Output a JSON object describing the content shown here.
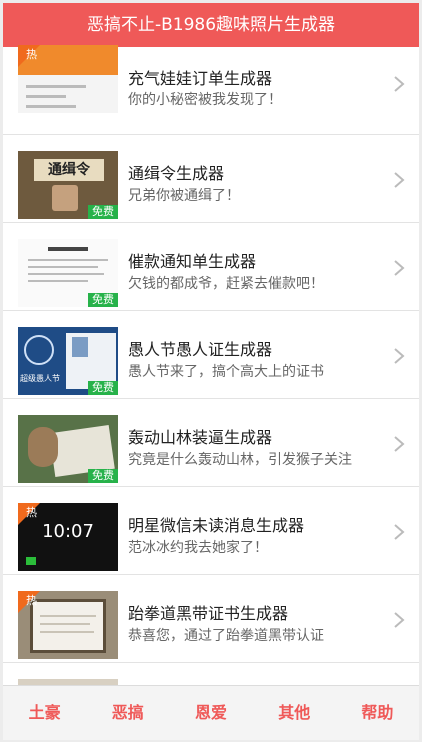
{
  "header": {
    "title": "恶搞不止-B1986趣味照片生成器"
  },
  "badges": {
    "hot": "热",
    "free": "免费"
  },
  "list": [
    {
      "title": "充气娃娃订单生成器",
      "subtitle": "你的小秘密被我发现了！",
      "badge": "hot"
    },
    {
      "title": "通缉令生成器",
      "subtitle": "兄弟你被通缉了！",
      "badge": "free",
      "thumb_text": "通缉令"
    },
    {
      "title": "催款通知单生成器",
      "subtitle": "欠钱的都成爷，赶紧去催款吧！",
      "badge": "free"
    },
    {
      "title": "愚人节愚人证生成器",
      "subtitle": "愚人节来了，搞个高大上的证书",
      "badge": "free",
      "thumb_text": "超级愚人节"
    },
    {
      "title": "轰动山林装逼生成器",
      "subtitle": "究竟是什么轰动山林，引发猴子关注",
      "badge": "free"
    },
    {
      "title": "明星微信未读消息生成器",
      "subtitle": "范冰冰约我去她家了！",
      "badge": "hot",
      "thumb_text": "10:07"
    },
    {
      "title": "跆拳道黑带证书生成器",
      "subtitle": "恭喜您，通过了跆拳道黑带认证",
      "badge": "hot"
    }
  ],
  "tabs": [
    "土豪",
    "恶搞",
    "恩爱",
    "其他",
    "帮助"
  ],
  "colors": {
    "accent": "#ef5958",
    "hot": "#f06a1d",
    "free": "#27b24a"
  }
}
